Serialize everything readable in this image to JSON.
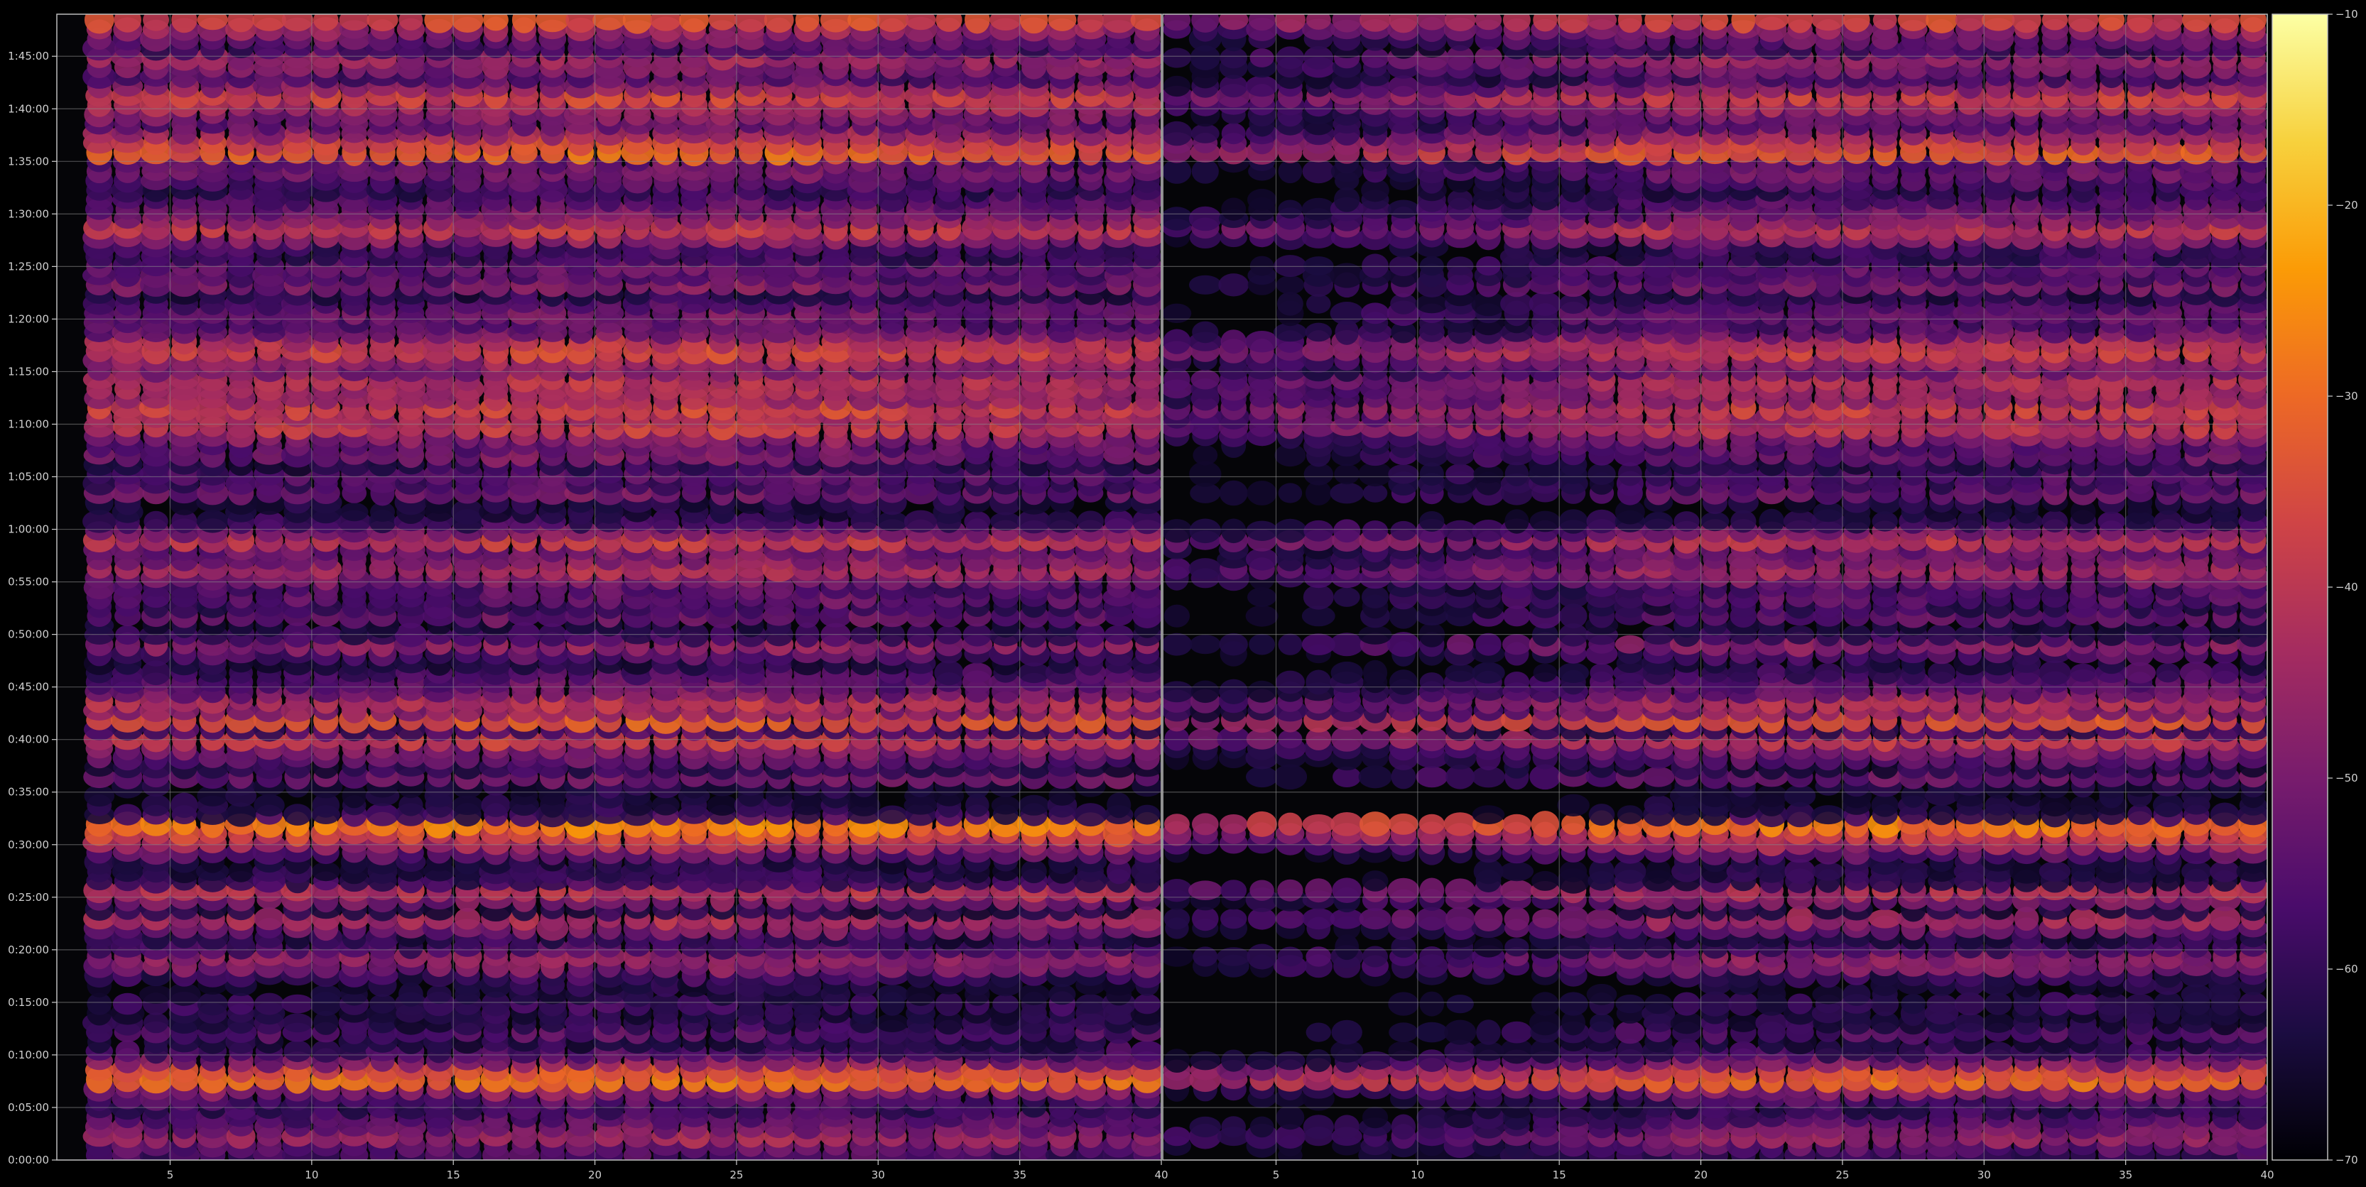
{
  "chart_data": {
    "type": "heatmap",
    "title": "",
    "xlabel": "",
    "ylabel": "",
    "colormap": "inferno",
    "colormap_stops": [
      "#000004",
      "#1b0c41",
      "#4a0c6b",
      "#781c6d",
      "#a52c60",
      "#cf4446",
      "#ed6925",
      "#fb9b06",
      "#f7d13d",
      "#fcffa4"
    ],
    "background": "#000000",
    "grid": true,
    "colorbar": {
      "position": "right",
      "range": [
        -70,
        -10
      ],
      "ticks": [
        -70,
        -60,
        -50,
        -40,
        -30,
        -20,
        -10
      ],
      "tick_labels": [
        "−70",
        "−60",
        "−50",
        "−40",
        "−30",
        "−20",
        "−10"
      ]
    },
    "panels": [
      {
        "name": "left",
        "x_range": [
          1,
          40
        ],
        "x_ticks": [
          5,
          10,
          15,
          20,
          25,
          30,
          35,
          40
        ],
        "x_tick_labels": [
          "5",
          "10",
          "15",
          "20",
          "25",
          "30",
          "35",
          "40"
        ],
        "columns_start": 2,
        "columns_end": 39,
        "fade_to": null
      },
      {
        "name": "right",
        "x_range": [
          1,
          40
        ],
        "x_ticks": [
          5,
          10,
          15,
          20,
          25,
          30,
          35,
          40
        ],
        "x_tick_labels": [
          "5",
          "10",
          "15",
          "20",
          "25",
          "30",
          "35",
          "40"
        ],
        "columns_start": 1,
        "columns_end": 39,
        "fade_to": 20
      }
    ],
    "y_range": [
      0,
      6540
    ],
    "y_unit": "seconds",
    "y_ticks": [
      0,
      300,
      600,
      900,
      1200,
      1500,
      1800,
      2100,
      2400,
      2700,
      3000,
      3300,
      3600,
      3900,
      4200,
      4500,
      4800,
      5100,
      5400,
      5700,
      6000,
      6300
    ],
    "y_tick_labels": [
      "0:00:00",
      "0:05:00",
      "0:10:00",
      "0:15:00",
      "0:20:00",
      "0:25:00",
      "0:30:00",
      "0:35:00",
      "0:40:00",
      "0:45:00",
      "0:50:00",
      "0:55:00",
      "1:00:00",
      "1:05:00",
      "1:10:00",
      "1:15:00",
      "1:20:00",
      "1:25:00",
      "1:30:00",
      "1:35:00",
      "1:40:00",
      "1:45:00"
    ],
    "row_step_seconds": 54,
    "row_values": [
      [
        0,
        -58
      ],
      [
        54,
        -54
      ],
      [
        108,
        -46
      ],
      [
        162,
        -52
      ],
      [
        216,
        -56
      ],
      [
        270,
        -60
      ],
      [
        324,
        -56
      ],
      [
        378,
        -48
      ],
      [
        432,
        -30
      ],
      [
        486,
        -36
      ],
      [
        540,
        -50
      ],
      [
        594,
        -58
      ],
      [
        648,
        -64
      ],
      [
        702,
        -56
      ],
      [
        756,
        -62
      ],
      [
        810,
        -64
      ],
      [
        864,
        -60
      ],
      [
        918,
        -66
      ],
      [
        972,
        -64
      ],
      [
        1026,
        -60
      ],
      [
        1080,
        -50
      ],
      [
        1134,
        -48
      ],
      [
        1188,
        -58
      ],
      [
        1242,
        -62
      ],
      [
        1296,
        -52
      ],
      [
        1350,
        -44
      ],
      [
        1404,
        -64
      ],
      [
        1458,
        -50
      ],
      [
        1512,
        -42
      ],
      [
        1566,
        -60
      ],
      [
        1620,
        -62
      ],
      [
        1674,
        -64
      ],
      [
        1728,
        -54
      ],
      [
        1782,
        -44
      ],
      [
        1836,
        -36
      ],
      [
        1890,
        -28
      ],
      [
        1944,
        -60
      ],
      [
        1998,
        -64
      ],
      [
        2052,
        -66
      ],
      [
        2106,
        -64
      ],
      [
        2160,
        -52
      ],
      [
        2214,
        -62
      ],
      [
        2268,
        -54
      ],
      [
        2322,
        -50
      ],
      [
        2376,
        -40
      ],
      [
        2430,
        -58
      ],
      [
        2484,
        -34
      ],
      [
        2538,
        -48
      ],
      [
        2592,
        -42
      ],
      [
        2646,
        -52
      ],
      [
        2700,
        -54
      ],
      [
        2754,
        -58
      ],
      [
        2808,
        -64
      ],
      [
        2862,
        -56
      ],
      [
        2916,
        -48
      ],
      [
        2970,
        -60
      ],
      [
        3024,
        -66
      ],
      [
        3078,
        -54
      ],
      [
        3132,
        -60
      ],
      [
        3186,
        -54
      ],
      [
        3240,
        -56
      ],
      [
        3294,
        -50
      ],
      [
        3348,
        -44
      ],
      [
        3402,
        -50
      ],
      [
        3456,
        -52
      ],
      [
        3510,
        -40
      ],
      [
        3564,
        -50
      ],
      [
        3618,
        -60
      ],
      [
        3672,
        -66
      ],
      [
        3726,
        -64
      ],
      [
        3780,
        -52
      ],
      [
        3834,
        -58
      ],
      [
        3888,
        -56
      ],
      [
        3942,
        -62
      ],
      [
        3996,
        -52
      ],
      [
        4050,
        -54
      ],
      [
        4104,
        -48
      ],
      [
        4158,
        -40
      ],
      [
        4212,
        -44
      ],
      [
        4266,
        -38
      ],
      [
        4320,
        -46
      ],
      [
        4374,
        -44
      ],
      [
        4428,
        -42
      ],
      [
        4482,
        -50
      ],
      [
        4536,
        -46
      ],
      [
        4590,
        -38
      ],
      [
        4644,
        -42
      ],
      [
        4698,
        -52
      ],
      [
        4752,
        -56
      ],
      [
        4806,
        -52
      ],
      [
        4860,
        -56
      ],
      [
        4914,
        -62
      ],
      [
        4968,
        -50
      ],
      [
        5022,
        -56
      ],
      [
        5076,
        -54
      ],
      [
        5130,
        -60
      ],
      [
        5184,
        -58
      ],
      [
        5238,
        -48
      ],
      [
        5292,
        -40
      ],
      [
        5346,
        -48
      ],
      [
        5400,
        -52
      ],
      [
        5454,
        -56
      ],
      [
        5508,
        -60
      ],
      [
        5562,
        -56
      ],
      [
        5616,
        -52
      ],
      [
        5670,
        -54
      ],
      [
        5724,
        -32
      ],
      [
        5778,
        -38
      ],
      [
        5832,
        -46
      ],
      [
        5886,
        -54
      ],
      [
        5940,
        -50
      ],
      [
        5994,
        -44
      ],
      [
        6048,
        -38
      ],
      [
        6102,
        -48
      ],
      [
        6156,
        -56
      ],
      [
        6210,
        -50
      ],
      [
        6264,
        -46
      ],
      [
        6318,
        -58
      ],
      [
        6372,
        -52
      ],
      [
        6426,
        -46
      ],
      [
        6480,
        -36
      ]
    ]
  }
}
